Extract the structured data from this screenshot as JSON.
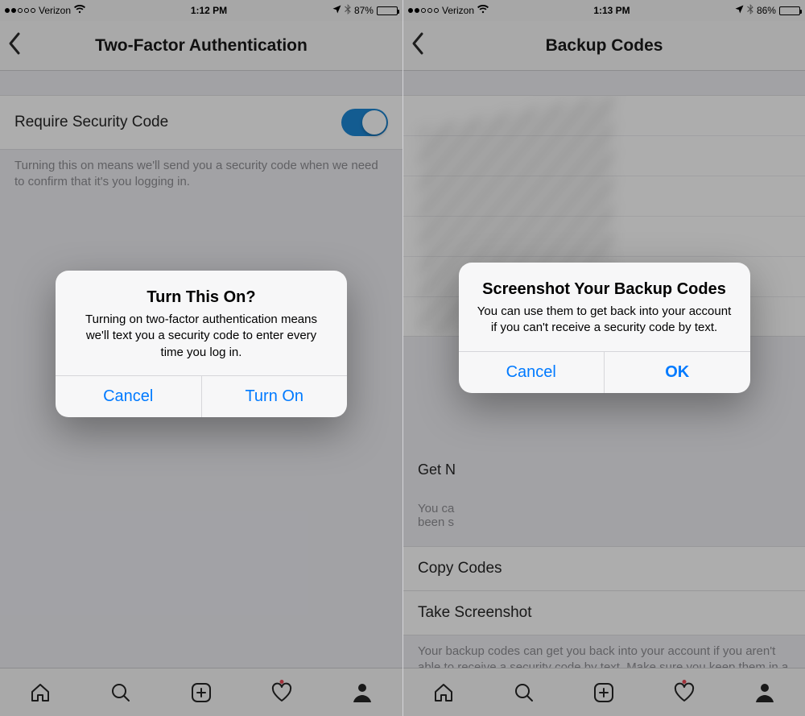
{
  "left": {
    "statusbar": {
      "carrier": "Verizon",
      "time": "1:12 PM",
      "battery_pct": "87%"
    },
    "nav_title": "Two-Factor Authentication",
    "setting_label": "Require Security Code",
    "setting_caption": "Turning this on means we'll send you a security code when we need to confirm that it's you logging in.",
    "alert": {
      "title": "Turn This On?",
      "message": "Turning on two-factor authentication means we'll text you a security code to enter every time you log in.",
      "cancel": "Cancel",
      "confirm": "Turn On"
    }
  },
  "right": {
    "statusbar": {
      "carrier": "Verizon",
      "time": "1:13 PM",
      "battery_pct": "86%"
    },
    "nav_title": "Backup Codes",
    "get_new_label": "Get N",
    "get_new_caption_visible": "You ca\nbeen s",
    "copy_label": "Copy Codes",
    "screenshot_label": "Take Screenshot",
    "footer_caption": "Your backup codes can get you back into your account if you aren't able to receive a security code by text. Make sure you keep them in a safe place.",
    "alert": {
      "title": "Screenshot Your Backup Codes",
      "message": "You can use them to get back into your account if you can't receive a security code by text.",
      "cancel": "Cancel",
      "confirm": "OK"
    }
  },
  "tabs": [
    "home",
    "search",
    "create",
    "activity",
    "profile"
  ]
}
